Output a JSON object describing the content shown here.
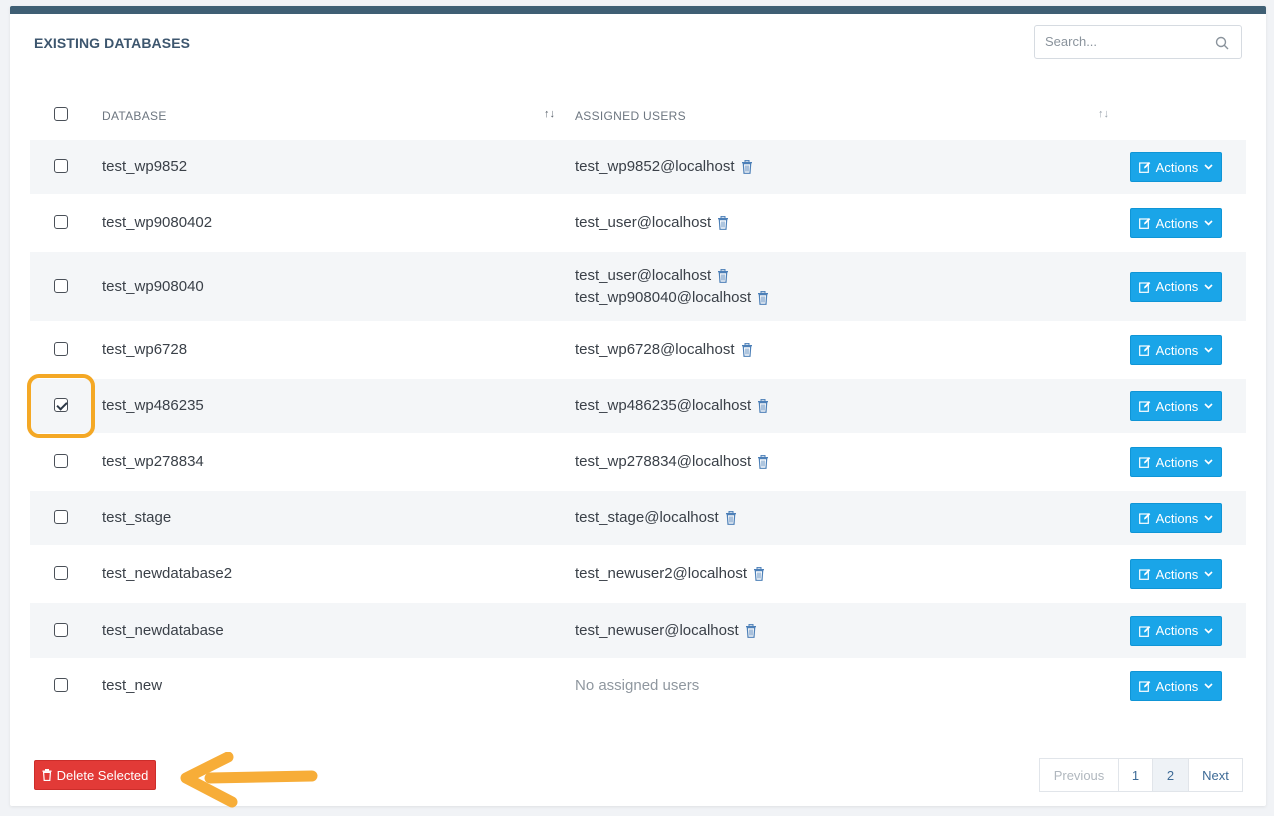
{
  "panel": {
    "title": "EXISTING DATABASES",
    "search_placeholder": "Search..."
  },
  "table": {
    "col_database": "DATABASE",
    "col_users": "ASSIGNED USERS",
    "sort_glyph": "↑↓",
    "actions_label": "Actions",
    "no_users_label": "No assigned users",
    "rows": [
      {
        "name": "test_wp9852",
        "users": [
          "test_wp9852@localhost"
        ],
        "checked": false
      },
      {
        "name": "test_wp9080402",
        "users": [
          "test_user@localhost"
        ],
        "checked": false
      },
      {
        "name": "test_wp908040",
        "users": [
          "test_user@localhost",
          "test_wp908040@localhost"
        ],
        "checked": false
      },
      {
        "name": "test_wp6728",
        "users": [
          "test_wp6728@localhost"
        ],
        "checked": false
      },
      {
        "name": "test_wp486235",
        "users": [
          "test_wp486235@localhost"
        ],
        "checked": true
      },
      {
        "name": "test_wp278834",
        "users": [
          "test_wp278834@localhost"
        ],
        "checked": false
      },
      {
        "name": "test_stage",
        "users": [
          "test_stage@localhost"
        ],
        "checked": false
      },
      {
        "name": "test_newdatabase2",
        "users": [
          "test_newuser2@localhost"
        ],
        "checked": false
      },
      {
        "name": "test_newdatabase",
        "users": [
          "test_newuser@localhost"
        ],
        "checked": false
      },
      {
        "name": "test_new",
        "users": [],
        "checked": false
      }
    ]
  },
  "footer": {
    "delete_label": "Delete Selected",
    "pagination": {
      "previous": "Previous",
      "pages": [
        "1",
        "2"
      ],
      "next": "Next"
    }
  },
  "colors": {
    "accent": "#1aa5e8",
    "danger": "#e23a37",
    "highlight": "#f4a825",
    "header_bar": "#3f5f74"
  }
}
